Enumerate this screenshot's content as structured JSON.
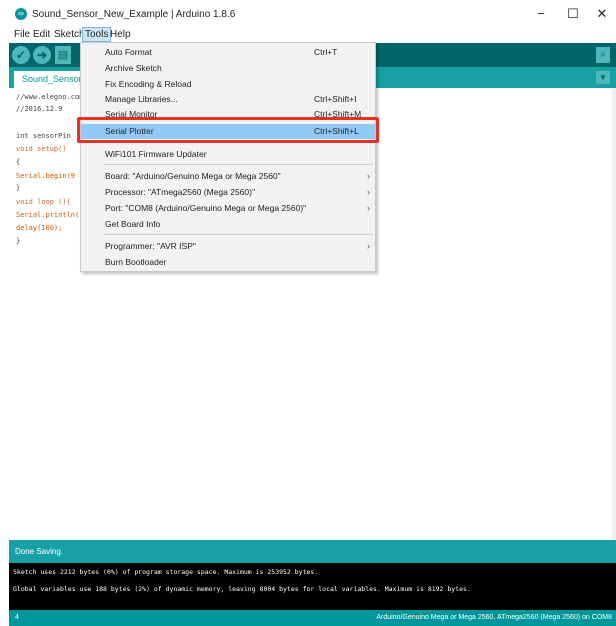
{
  "window": {
    "title": "Sound_Sensor_New_Example | Arduino 1.8.6",
    "minimize": "−",
    "maximize": "☐",
    "close": "✕"
  },
  "menubar": [
    "File",
    "Edit",
    "Sketch",
    "Tools",
    "Help"
  ],
  "toolbar": {
    "verify": "✓",
    "upload": "➔",
    "new": "▤",
    "serial_monitor": "⌕"
  },
  "tab": {
    "name": "Sound_Sensor",
    "menu": "▼"
  },
  "code_lines": [
    {
      "text": "//www.elegoo.com",
      "style": "comment"
    },
    {
      "text": "//2016.12.9",
      "style": "comment"
    },
    {
      "text": "",
      "style": "plain"
    },
    {
      "text": "int sensorPin",
      "style": "plain"
    },
    {
      "text": "void setup()",
      "style": "kw"
    },
    {
      "text": "{",
      "style": "plain"
    },
    {
      "text": "Serial.begin(9",
      "style": "fn"
    },
    {
      "text": "}",
      "style": "plain"
    },
    {
      "text": "void loop (){",
      "style": "kw"
    },
    {
      "text": "Serial.println(",
      "style": "fn"
    },
    {
      "text": "delay(100);",
      "style": "fn"
    },
    {
      "text": "}",
      "style": "plain"
    }
  ],
  "tools_menu": {
    "items": [
      {
        "label": "Auto Format",
        "shortcut": "Ctrl+T"
      },
      {
        "label": "Archive Sketch",
        "shortcut": ""
      },
      {
        "label": "Fix Encoding & Reload",
        "shortcut": ""
      },
      {
        "label": "Manage Libraries...",
        "shortcut": "Ctrl+Shift+I"
      },
      {
        "label": "Serial Monitor",
        "shortcut": "Ctrl+Shift+M"
      },
      {
        "label": "Serial Plotter",
        "shortcut": "Ctrl+Shift+L"
      },
      {
        "label": "WiFi101 Firmware Updater",
        "shortcut": ""
      },
      {
        "label": "Board: \"Arduino/Genuino Mega or Mega 2560\"",
        "shortcut": ""
      },
      {
        "label": "Processor: \"ATmega2560 (Mega 2560)\"",
        "shortcut": ""
      },
      {
        "label": "Port: \"COM8 (Arduino/Genuino Mega or Mega 2560)\"",
        "shortcut": ""
      },
      {
        "label": "Get Board Info",
        "shortcut": ""
      },
      {
        "label": "Programmer: \"AVR ISP\"",
        "shortcut": ""
      },
      {
        "label": "Burn Bootloader",
        "shortcut": ""
      }
    ],
    "submenu_arrow": "›"
  },
  "status": {
    "message": "Done Saving.",
    "console_lines": [
      "Sketch uses 2212 bytes (0%) of program storage space. Maximum is 253952 bytes.",
      "Global variables use 188 bytes (2%) of dynamic memory, leaving 8004 bytes for local variables. Maximum is 8192 bytes."
    ],
    "line_number": "4",
    "board_info": "Arduino/Genuino Mega or Mega 2560, ATmega2560 (Mega 2560) on COM8"
  },
  "colors": {
    "toolbar": "#006468",
    "accent": "#00979c",
    "highlight_box": "#e53323",
    "menu_selected": "#91c9f7"
  }
}
